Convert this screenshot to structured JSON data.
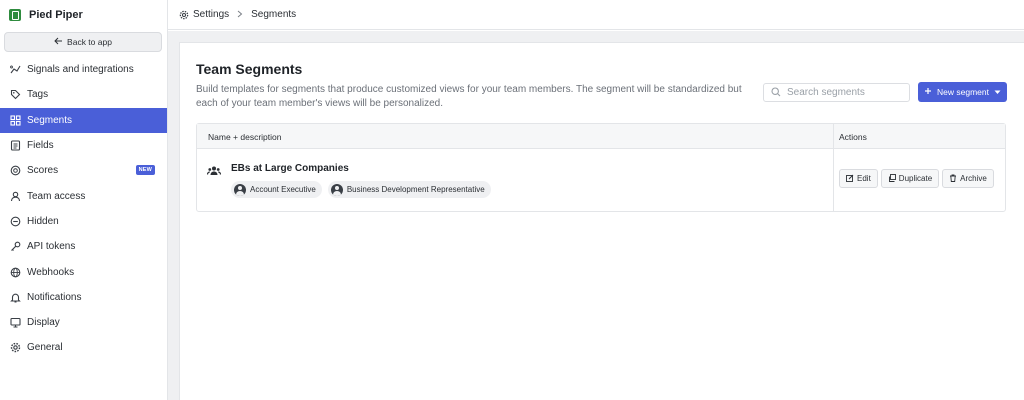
{
  "brand": {
    "name": "Pied Piper"
  },
  "sidebar": {
    "back_label": "Back to app",
    "items": [
      {
        "label": "Signals and integrations",
        "icon": "signals-icon"
      },
      {
        "label": "Tags",
        "icon": "tag-icon"
      },
      {
        "label": "Segments",
        "icon": "grid-icon",
        "active": true
      },
      {
        "label": "Fields",
        "icon": "fields-icon"
      },
      {
        "label": "Scores",
        "icon": "score-icon",
        "badge": "NEW"
      },
      {
        "label": "Team access",
        "icon": "user-icon"
      },
      {
        "label": "Hidden",
        "icon": "hidden-icon"
      },
      {
        "label": "API tokens",
        "icon": "key-icon"
      },
      {
        "label": "Webhooks",
        "icon": "globe-icon"
      },
      {
        "label": "Notifications",
        "icon": "bell-icon"
      },
      {
        "label": "Display",
        "icon": "monitor-icon"
      },
      {
        "label": "General",
        "icon": "gear-icon"
      }
    ]
  },
  "breadcrumb": {
    "parent": "Settings",
    "current": "Segments"
  },
  "page": {
    "title": "Team Segments",
    "description": "Build templates for segments that produce customized views for your team members. The segment will be standardized but each of your team member's views will be personalized.",
    "search_placeholder": "Search segments",
    "new_button": "New segment"
  },
  "table": {
    "col_name": "Name + description",
    "col_actions": "Actions",
    "rows": [
      {
        "name": "EBs at Large Companies",
        "roles": [
          "Account Executive",
          "Business Development Representative"
        ],
        "actions": [
          "Edit",
          "Duplicate",
          "Archive"
        ]
      }
    ]
  },
  "colors": {
    "accent": "#4a5fd8",
    "brand": "#2e8b3e"
  }
}
